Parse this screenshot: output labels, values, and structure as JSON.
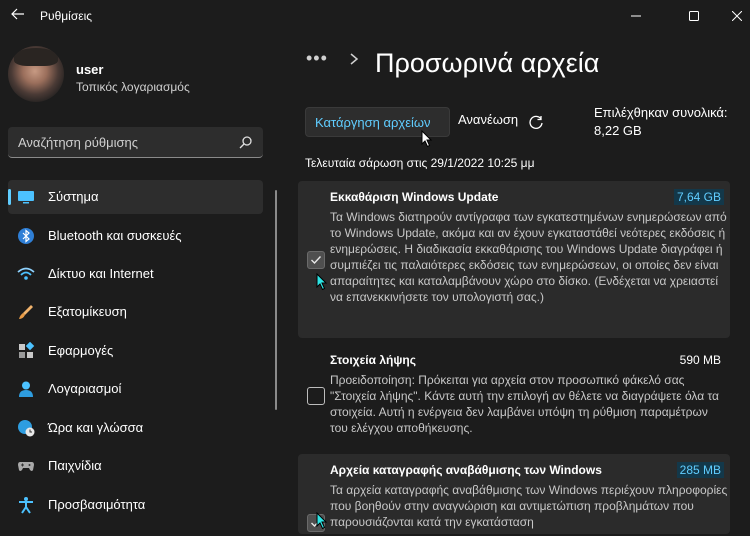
{
  "window": {
    "title": "Ρυθμίσεις",
    "controls": {
      "minimize": "minimize-icon",
      "maximize": "maximize-icon",
      "close": "close-icon"
    }
  },
  "user": {
    "name": "user",
    "account_type": "Τοπικός λογαριασμός"
  },
  "search": {
    "placeholder": "Αναζήτηση ρύθμισης",
    "icon": "search-icon"
  },
  "nav": {
    "items": [
      {
        "label": "Σύστημα",
        "icon": "system-monitor-icon",
        "active": true
      },
      {
        "label": "Bluetooth και συσκευές",
        "icon": "bluetooth-icon",
        "active": false
      },
      {
        "label": "Δίκτυο και Internet",
        "icon": "wifi-icon",
        "active": false
      },
      {
        "label": "Εξατομίκευση",
        "icon": "brush-icon",
        "active": false
      },
      {
        "label": "Εφαρμογές",
        "icon": "apps-icon",
        "active": false
      },
      {
        "label": "Λογαριασμοί",
        "icon": "account-icon",
        "active": false
      },
      {
        "label": "Ώρα και γλώσσα",
        "icon": "globe-clock-icon",
        "active": false
      },
      {
        "label": "Παιχνίδια",
        "icon": "gamepad-icon",
        "active": false
      },
      {
        "label": "Προσβασιμότητα",
        "icon": "accessibility-icon",
        "active": false
      }
    ]
  },
  "breadcrumb": {
    "overflow": "•••",
    "title": "Προσωρινά αρχεία"
  },
  "toolbar": {
    "remove_label": "Κατάργηση αρχείων",
    "refresh_label": "Ανανέωση",
    "selected_label": "Επιλέχθηκαν συνολικά:",
    "selected_size": "8,22 GB"
  },
  "last_scan": "Τελευταία σάρωση στις 29/1/2022 10:25 μμ",
  "colors": {
    "accent": "#60cdff",
    "background": "#1c1c1c",
    "card": "#2b2b2b"
  },
  "items": [
    {
      "title": "Εκκαθάριση Windows Update",
      "size": "7,64 GB",
      "checked": true,
      "description": "Τα Windows διατηρούν αντίγραφα των εγκατεστημένων ενημερώσεων από το Windows Update, ακόμα και αν έχουν εγκαταστάθεί νεότερες εκδόσεις ή ενημερώσεις. Η διαδικασία εκκαθάρισης του Windows Update διαγράφει ή συμπιέζει τις παλαιότερες εκδόσεις των ενημερώσεων, οι οποίες δεν είναι απαραίτητες και καταλαμβάνουν χώρο στο δίσκο. (Ενδέχεται να χρειαστεί να επανεκκινήσετε τον υπολογιστή σας.)"
    },
    {
      "title": "Στοιχεία λήψης",
      "size": "590 MB",
      "checked": false,
      "description": "Προειδοποίηση: Πρόκειται για αρχεία στον προσωπικό φάκελό σας \"Στοιχεία λήψης\". Κάντε αυτή την επιλογή αν θέλετε να διαγράψετε όλα τα στοιχεία. Αυτή η ενέργεια δεν λαμβάνει υπόψη τη ρύθμιση παραμέτρων του ελέγχου αποθήκευσης."
    },
    {
      "title": "Αρχεία καταγραφής αναβάθμισης των Windows",
      "size": "285 MB",
      "checked": true,
      "description": "Τα αρχεία καταγραφής αναβάθμισης των Windows περιέχουν πληροφορίες που βοηθούν στην αναγνώριση και αντιμετώπιση προβλημάτων που παρουσιάζονται κατά την εγκατάσταση"
    }
  ]
}
